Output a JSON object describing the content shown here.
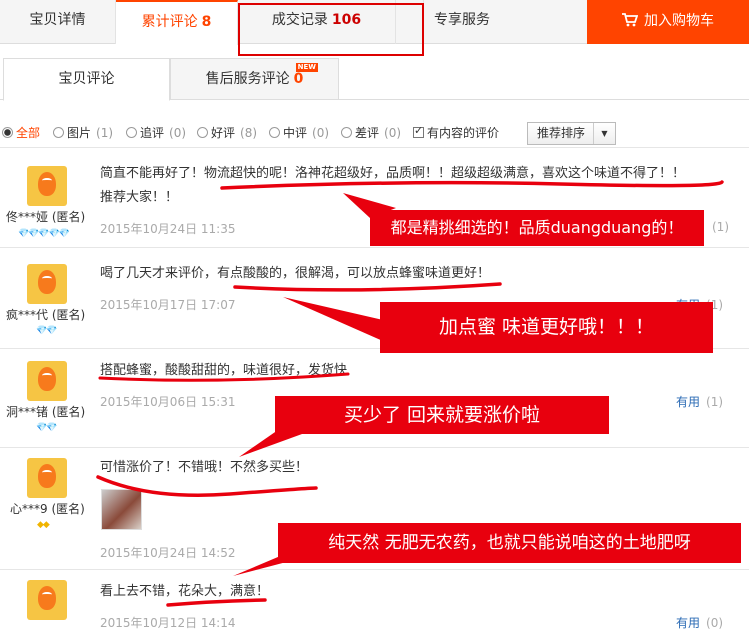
{
  "tabs": {
    "detail": "宝贝详情",
    "reviews": "累计评论",
    "reviews_count": "8",
    "trades": "成交记录",
    "trades_count": "106",
    "service": "专享服务",
    "cart": "加入购物车"
  },
  "subtabs": {
    "reviews": "宝贝评论",
    "aftersale": "售后服务评论",
    "aftersale_count": "0",
    "new_badge": "NEW"
  },
  "filters": {
    "all": "全部",
    "pictures": "图片",
    "pictures_count": "(1)",
    "followup": "追评",
    "followup_count": "(0)",
    "good": "好评",
    "good_count": "(8)",
    "medium": "中评",
    "medium_count": "(0)",
    "bad": "差评",
    "bad_count": "(0)",
    "with_content": "有内容的评价",
    "sort": "推荐排序"
  },
  "reviews": [
    {
      "user": "佟***娅 (匿名)",
      "text1": "简直不能再好了！物流超快的呢！洛神花超级好，品质啊！！超级超级满意，喜欢这个味道不得了！！",
      "text2": "推荐大家！！",
      "date": "2015年10月24日 11:35",
      "useful": "",
      "useful_count": "(1)",
      "gems": "💎💎💎💎💎"
    },
    {
      "user": "疯***代 (匿名)",
      "text1": "喝了几天才来评价，有点酸酸的，很解渴，可以放点蜂蜜味道更好！",
      "date": "2015年10月17日 17:07",
      "useful": "有用",
      "useful_count": "(1)",
      "gems": "💎💎"
    },
    {
      "user": "洞***锗 (匿名)",
      "text1": "搭配蜂蜜，酸酸甜甜的，味道很好，发货快",
      "date": "2015年10月06日 15:31",
      "useful": "有用",
      "useful_count": "(1)",
      "gems": "💎💎"
    },
    {
      "user": "心***9 (匿名)",
      "text1": "可惜涨价了！不错哦！不然多买些！",
      "date": "2015年10月24日 14:52",
      "gems": "◆◆"
    },
    {
      "user": "",
      "text1": "看上去不错，花朵大，满意！",
      "date": "2015年10月12日 14:14",
      "useful": "有用",
      "useful_count": "(0)"
    }
  ],
  "annotations": {
    "a1": "都是精挑细选的！品质duangduang的！",
    "a2": "加点蜜  味道更好哦！！！",
    "a3": "买少了  回来就要涨价啦",
    "a4": "纯天然  无肥无农药，也就只能说咱这的土地肥呀"
  },
  "colors": {
    "accent": "#ff4400",
    "annotation": "#e8000e"
  }
}
